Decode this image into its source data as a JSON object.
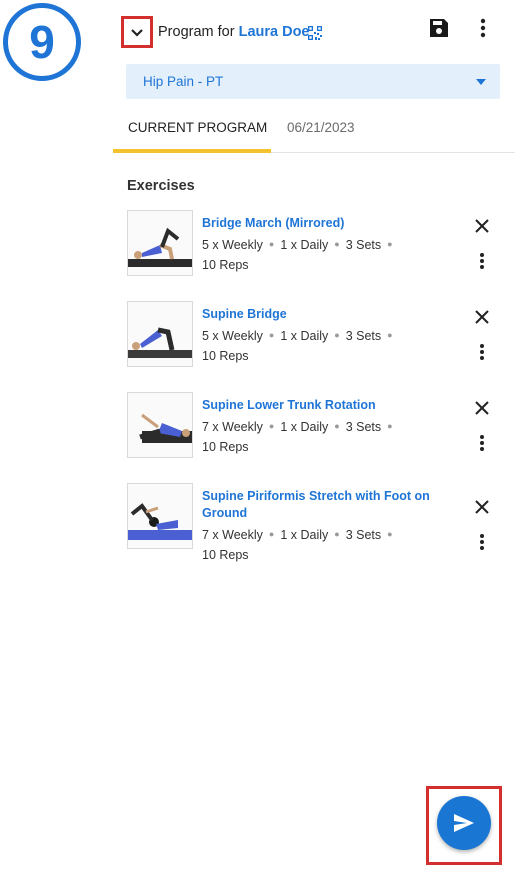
{
  "step": {
    "number": "9"
  },
  "header": {
    "program_prefix": "Program for",
    "patient_name": "Laura Doe"
  },
  "program_select": {
    "value": "Hip Pain - PT"
  },
  "tabs": [
    {
      "label": "CURRENT PROGRAM",
      "active": true
    },
    {
      "label": "06/21/2023",
      "active": false
    }
  ],
  "exercises_section": {
    "title": "Exercises"
  },
  "exercises": [
    {
      "title": "Bridge March (Mirrored)",
      "weekly": "5 x Weekly",
      "daily": "1 x Daily",
      "sets": "3 Sets",
      "reps": "10 Reps"
    },
    {
      "title": "Supine Bridge",
      "weekly": "5 x Weekly",
      "daily": "1 x Daily",
      "sets": "3 Sets",
      "reps": "10 Reps"
    },
    {
      "title": "Supine Lower Trunk Rotation",
      "weekly": "7 x Weekly",
      "daily": "1 x Daily",
      "sets": "3 Sets",
      "reps": "10 Reps"
    },
    {
      "title": "Supine Piriformis Stretch with Foot on Ground",
      "weekly": "7 x Weekly",
      "daily": "1 x Daily",
      "sets": "3 Sets",
      "reps": "10 Reps"
    }
  ],
  "colors": {
    "accent": "#1f75d6",
    "tab_indicator": "#f2c230",
    "highlight_frame": "#d32f2f",
    "select_bg": "#e3f0fc"
  }
}
